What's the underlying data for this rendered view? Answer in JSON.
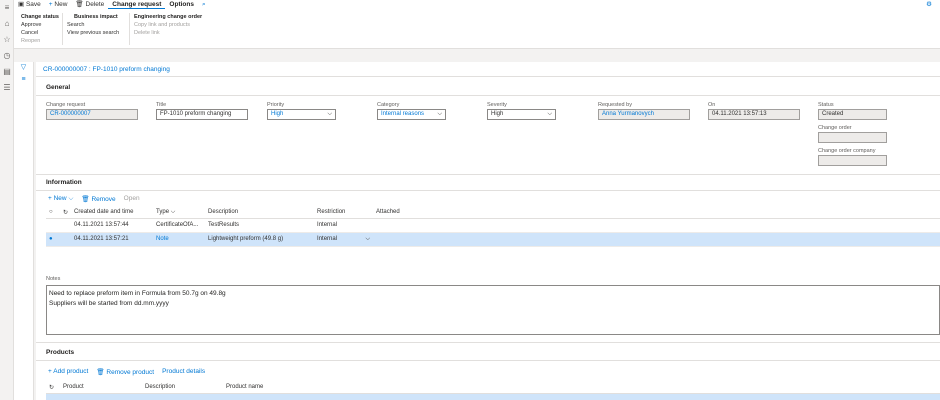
{
  "actionbar": {
    "save": "Save",
    "new": "New",
    "delete": "Delete",
    "tab_change_request": "Change request",
    "tab_options": "Options"
  },
  "ribbon": {
    "change_status": {
      "header": "Change status",
      "items": [
        "Approve",
        "Cancel",
        "Reopen"
      ]
    },
    "business_impact": {
      "header": "Business impact",
      "items": [
        "Search",
        "View previous search"
      ]
    },
    "engineering_change_order": {
      "header": "Engineering change order",
      "items": [
        "Copy link and products",
        "Delete link"
      ]
    }
  },
  "breadcrumb": "CR-000000007 : FP-1010 preform changing",
  "general": {
    "section": "General",
    "change_request": {
      "label": "Change request",
      "value": "CR-000000007"
    },
    "title": {
      "label": "Title",
      "value": "FP-1010 preform changing"
    },
    "priority": {
      "label": "Priority",
      "value": "High"
    },
    "category": {
      "label": "Category",
      "value": "Internal reasons"
    },
    "severity": {
      "label": "Severity",
      "value": "High"
    },
    "requested_by": {
      "label": "Requested by",
      "value": "Anna Yurmanovych"
    },
    "on": {
      "label": "On",
      "value": "04.11.2021 13:57:13"
    },
    "status": {
      "label": "Status",
      "value": "Created"
    },
    "change_order": {
      "label": "Change order",
      "value": ""
    },
    "change_order_company": {
      "label": "Change order company",
      "value": ""
    }
  },
  "information": {
    "section": "Information",
    "toolbar": {
      "new": "New",
      "remove": "Remove",
      "open": "Open"
    },
    "columns": [
      "Created date and time",
      "Type",
      "Description",
      "Restriction",
      "Attached"
    ],
    "rows": [
      {
        "created": "04.11.2021 13:57:44",
        "type": "CertificateOfA...",
        "description": "TestResults",
        "restriction": "Internal",
        "attached": ""
      },
      {
        "created": "04.11.2021 13:57:21",
        "type": "Note",
        "description": "Lightweight preform (49.8 g)",
        "restriction": "Internal",
        "attached": ""
      }
    ]
  },
  "notes": {
    "label": "Notes",
    "line1": "Need to replace preform item in Formula from 50.7g on 49.8g",
    "line2": "Suppliers will be started from dd.mm.yyyy"
  },
  "products": {
    "section": "Products",
    "toolbar": {
      "add": "Add product",
      "remove": "Remove product",
      "details": "Product details"
    },
    "columns": [
      "Product",
      "Description",
      "Product name"
    ]
  },
  "colors": {
    "accent": "#0078d4",
    "selected_row": "#cfe4fa"
  }
}
